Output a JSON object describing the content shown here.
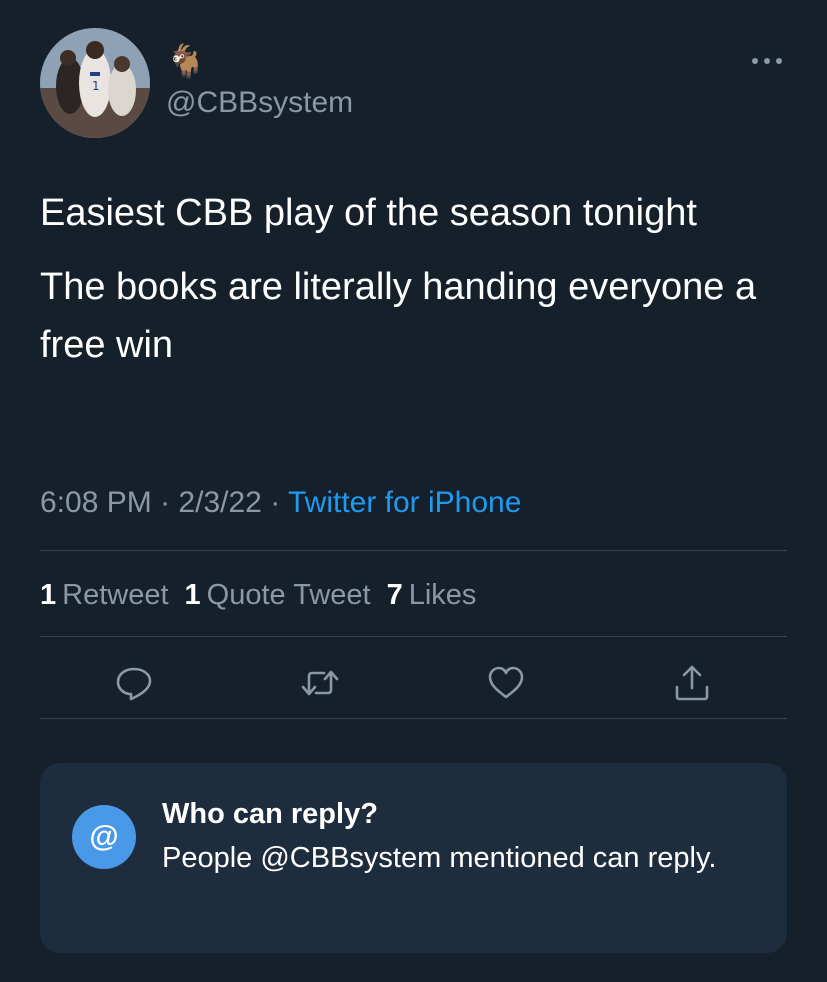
{
  "author": {
    "display_name": "🐐",
    "handle": "@CBBsystem"
  },
  "tweet": {
    "paragraph_1": "Easiest CBB play of the season tonight",
    "paragraph_2": "The books are literally handing everyone a free win",
    "time": "6:08 PM",
    "date": "2/3/22",
    "separator": "·",
    "source": "Twitter for iPhone"
  },
  "stats": {
    "retweets_count": "1",
    "retweets_label": "Retweet",
    "quotes_count": "1",
    "quotes_label": "Quote Tweet",
    "likes_count": "7",
    "likes_label": "Likes"
  },
  "actions": {
    "reply_icon": "reply-icon",
    "retweet_icon": "retweet-icon",
    "like_icon": "heart-icon",
    "share_icon": "share-icon"
  },
  "reply_settings": {
    "icon_glyph": "@",
    "title": "Who can reply?",
    "body": "People @CBBsystem mentioned can reply."
  },
  "colors": {
    "background": "#15202b",
    "accent": "#1d9bf0",
    "secondary_text": "#8b98a5",
    "panel_background": "#1e2d3d",
    "panel_icon": "#4a99e9"
  }
}
